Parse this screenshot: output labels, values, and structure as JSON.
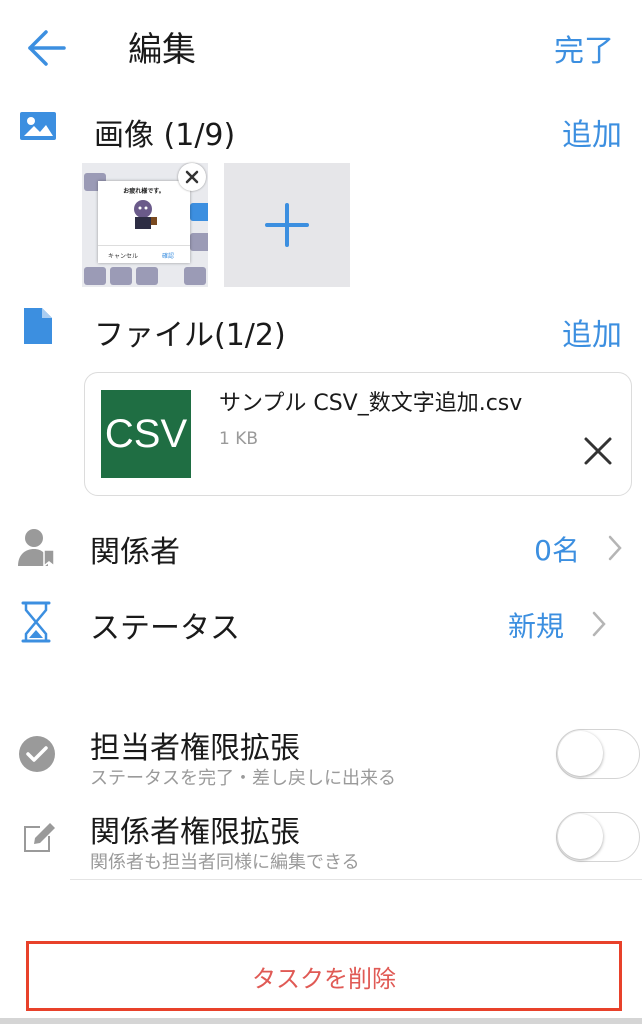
{
  "header": {
    "title": "編集",
    "done_label": "完了"
  },
  "images": {
    "label": "画像 (1/9)",
    "add_label": "追加",
    "thumbnail": {
      "dialog_title": "お疲れ様です。",
      "cancel_label": "キャンセル",
      "confirm_label": "確認"
    }
  },
  "files": {
    "label": "ファイル(1/2)",
    "add_label": "追加",
    "items": [
      {
        "badge": "CSV",
        "name": "サンプル CSV_数文字追加.csv",
        "size": "1 KB"
      }
    ]
  },
  "rows": {
    "members": {
      "label": "関係者",
      "value": "0名"
    },
    "status": {
      "label": "ステータス",
      "value": "新規"
    }
  },
  "permissions": [
    {
      "title": "担当者権限拡張",
      "description": "ステータスを完了・差し戻しに出来る",
      "enabled": false
    },
    {
      "title": "関係者権限拡張",
      "description": "関係者も担当者同様に編集できる",
      "enabled": false
    }
  ],
  "delete_label": "タスクを削除",
  "colors": {
    "accent": "#3c8fe0",
    "delete_border": "#e8412a",
    "delete_text": "#e05a55",
    "csv_badge": "#1f6e43"
  }
}
